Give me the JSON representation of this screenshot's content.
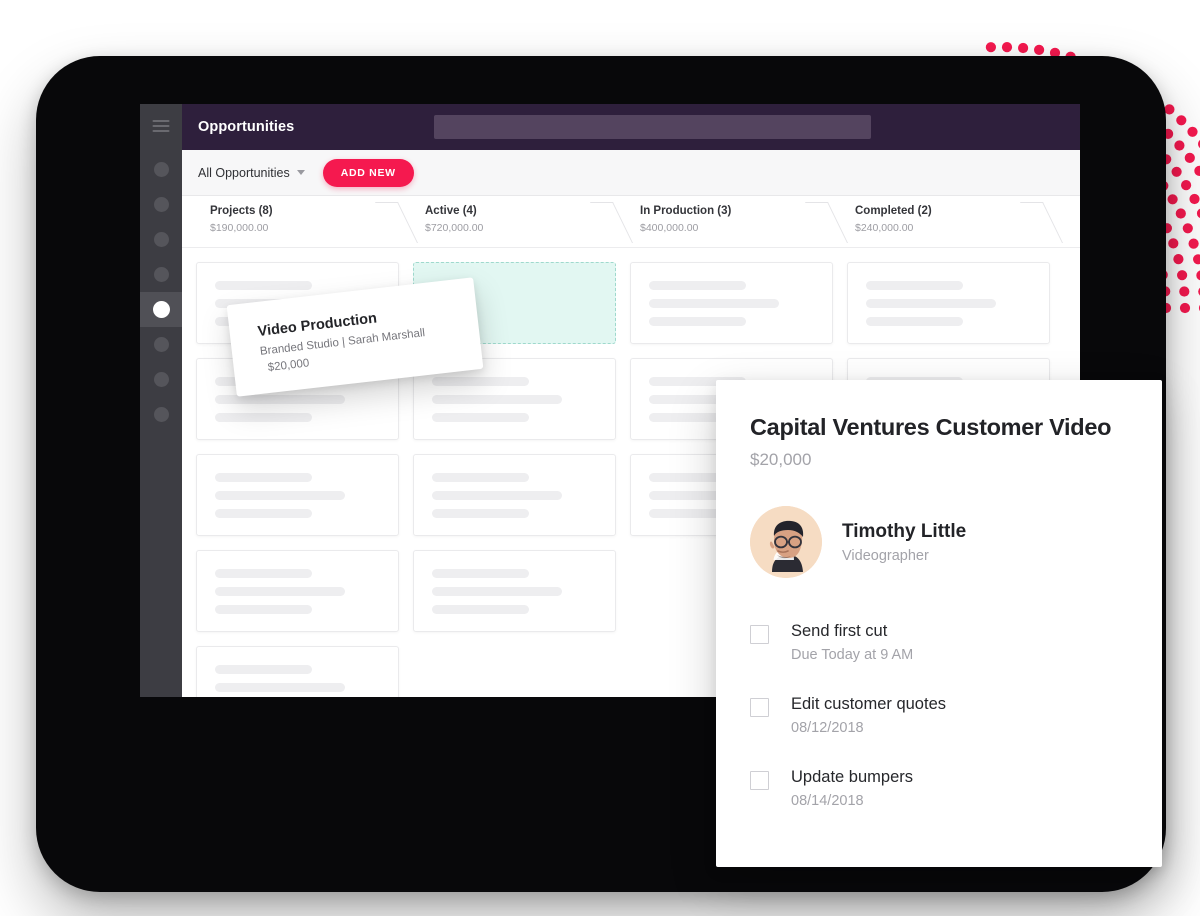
{
  "app": {
    "title": "Opportunities",
    "search_placeholder": ""
  },
  "sidebar": {
    "menu_icon": "hamburger-icon",
    "items": [
      {
        "name": "nav-dot-1",
        "active": false
      },
      {
        "name": "nav-dot-2",
        "active": false
      },
      {
        "name": "nav-dot-3",
        "active": false
      },
      {
        "name": "nav-dot-4",
        "active": false
      },
      {
        "name": "nav-dot-5",
        "active": true
      },
      {
        "name": "nav-dot-6",
        "active": false
      },
      {
        "name": "nav-dot-7",
        "active": false
      },
      {
        "name": "nav-dot-8",
        "active": false
      }
    ]
  },
  "toolbar": {
    "filter_label": "All Opportunities",
    "add_new_label": "ADD NEW"
  },
  "stages": [
    {
      "name": "Projects (8)",
      "value": "$190,000.00"
    },
    {
      "name": "Active (4)",
      "value": "$720,000.00"
    },
    {
      "name": "In Production (3)",
      "value": "$400,000.00"
    },
    {
      "name": "Completed (2)",
      "value": "$240,000.00"
    }
  ],
  "drag_card": {
    "title": "Video Production",
    "subtitle": "Branded Studio | Sarah Marshall",
    "amount": "$20,000"
  },
  "detail": {
    "title": "Capital Ventures Customer Video",
    "amount": "$20,000",
    "owner": {
      "name": "Timothy Little",
      "role": "Videographer",
      "avatar": "person-portrait-avatar"
    },
    "tasks": [
      {
        "label": "Send first cut",
        "due": "Due Today at 9 AM"
      },
      {
        "label": "Edit customer quotes",
        "due": "08/12/2018"
      },
      {
        "label": "Update bumpers",
        "due": "08/14/2018"
      }
    ]
  },
  "colors": {
    "accent_pink": "#f5194f",
    "header_purple": "#2e1f3c",
    "search_purple": "#54445f",
    "sidebar_dark": "#3d3d43",
    "drop_target_mint": "#e2f7f2",
    "drop_target_border": "#9fd9cd"
  },
  "decor": {
    "dot_pattern": "pink-dot-fan",
    "dot_color": "#f5194f",
    "device_frame": "tablet-frame"
  }
}
